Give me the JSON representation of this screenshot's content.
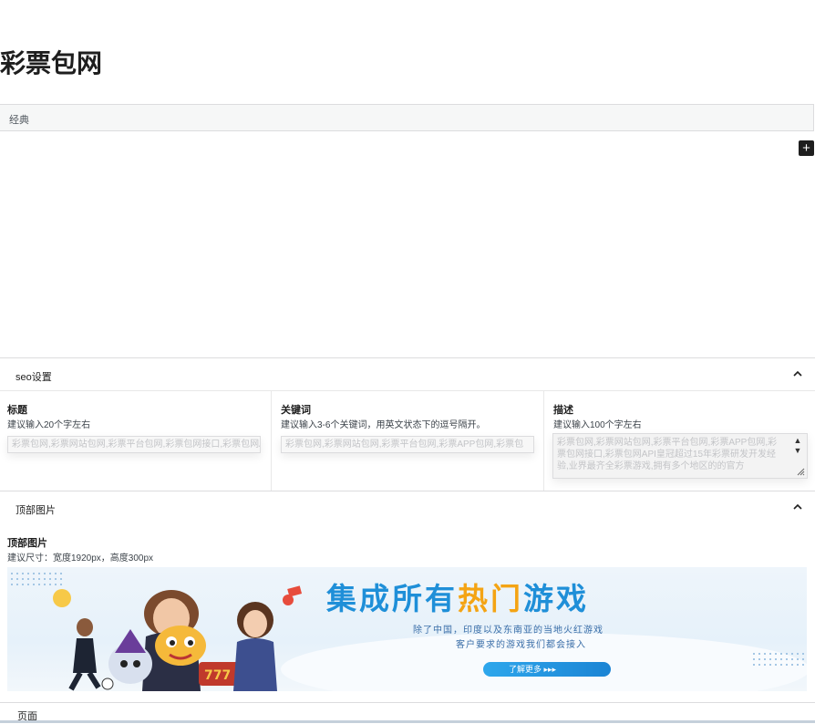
{
  "page": {
    "title": "彩票包网"
  },
  "tabs": [
    {
      "label": "经典"
    }
  ],
  "toolbar": {
    "add_label": "+"
  },
  "seo_panel": {
    "title": "seo设置",
    "fields": [
      {
        "label": "标题",
        "help": "建议输入20个字左右",
        "value": "彩票包网,彩票网站包网,彩票平台包网,彩票包网接口,彩票包网APP"
      },
      {
        "label": "关键词",
        "help": "建议输入3-6个关键词，用英文状态下的逗号隔开。",
        "value": "彩票包网,彩票网站包网,彩票平台包网,彩票APP包网,彩票包"
      },
      {
        "label": "描述",
        "help": "建议输入100个字左右",
        "value": "彩票包网,彩票网站包网,彩票平台包网,彩票APP包网,彩票包网接口,彩票包网API皇冠超过15年彩票研发开发经验,业界最齐全彩票游戏,拥有多个地区的的官方"
      }
    ]
  },
  "image_panel": {
    "title": "顶部图片",
    "field_label": "顶部图片",
    "help": "建议尺寸：宽度1920px，高度300px",
    "banner": {
      "headline_parts": [
        {
          "text": "集成所有",
          "color": "#1f8fd8"
        },
        {
          "text": "热门",
          "color": "#f4a414"
        },
        {
          "text": "游戏",
          "color": "#1f8fd8"
        }
      ],
      "sub1": "除了中国，印度以及东南亚的当地火红游戏",
      "sub2": "客户要求的游戏我们都会接入",
      "cta": "了解更多 ▸▸▸"
    }
  },
  "footer": {
    "label": "页面"
  }
}
